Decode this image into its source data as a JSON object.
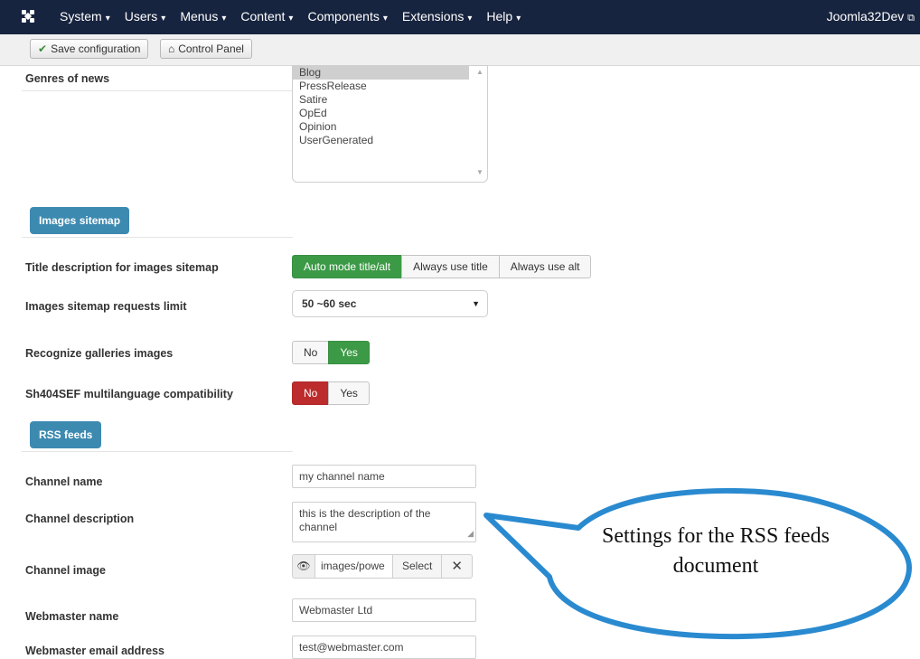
{
  "navbar": {
    "menu": [
      "System",
      "Users",
      "Menus",
      "Content",
      "Components",
      "Extensions",
      "Help"
    ],
    "site_name": "Joomla32Dev"
  },
  "toolbar": {
    "save_label": "Save configuration",
    "control_panel_label": "Control Panel"
  },
  "genres": {
    "label": "Genres of news",
    "options": [
      "Blog",
      "PressRelease",
      "Satire",
      "OpEd",
      "Opinion",
      "UserGenerated"
    ],
    "selected": "Blog"
  },
  "images_sitemap": {
    "section_label": "Images sitemap",
    "title_desc_label": "Title description for images sitemap",
    "title_desc_options": [
      "Auto mode title/alt",
      "Always use title",
      "Always use alt"
    ],
    "title_desc_selected": "Auto mode title/alt",
    "requests_limit_label": "Images sitemap requests limit",
    "requests_limit_value": "50 ~60 sec",
    "galleries_label": "Recognize galleries images",
    "galleries_no": "No",
    "galleries_yes": "Yes",
    "galleries_value": "Yes",
    "sh404_label": "Sh404SEF multilanguage compatibility",
    "sh404_no": "No",
    "sh404_yes": "Yes",
    "sh404_value": "No"
  },
  "rss": {
    "section_label": "RSS feeds",
    "channel_name_label": "Channel name",
    "channel_name_value": "my channel name",
    "channel_desc_label": "Channel description",
    "channel_desc_value": "this is the description of the channel",
    "channel_image_label": "Channel image",
    "channel_image_path": "images/powe",
    "channel_image_select": "Select",
    "webmaster_name_label": "Webmaster name",
    "webmaster_name_value": "Webmaster Ltd",
    "webmaster_email_label": "Webmaster email address",
    "webmaster_email_value": "test@webmaster.com"
  },
  "callout": {
    "text": "Settings for the RSS feeds document"
  },
  "colors": {
    "navbar": "#17243f",
    "section": "#3d8ab1",
    "active_green": "#3c9a46",
    "active_red": "#bd2c2c",
    "callout_border": "#2a8ad0"
  }
}
